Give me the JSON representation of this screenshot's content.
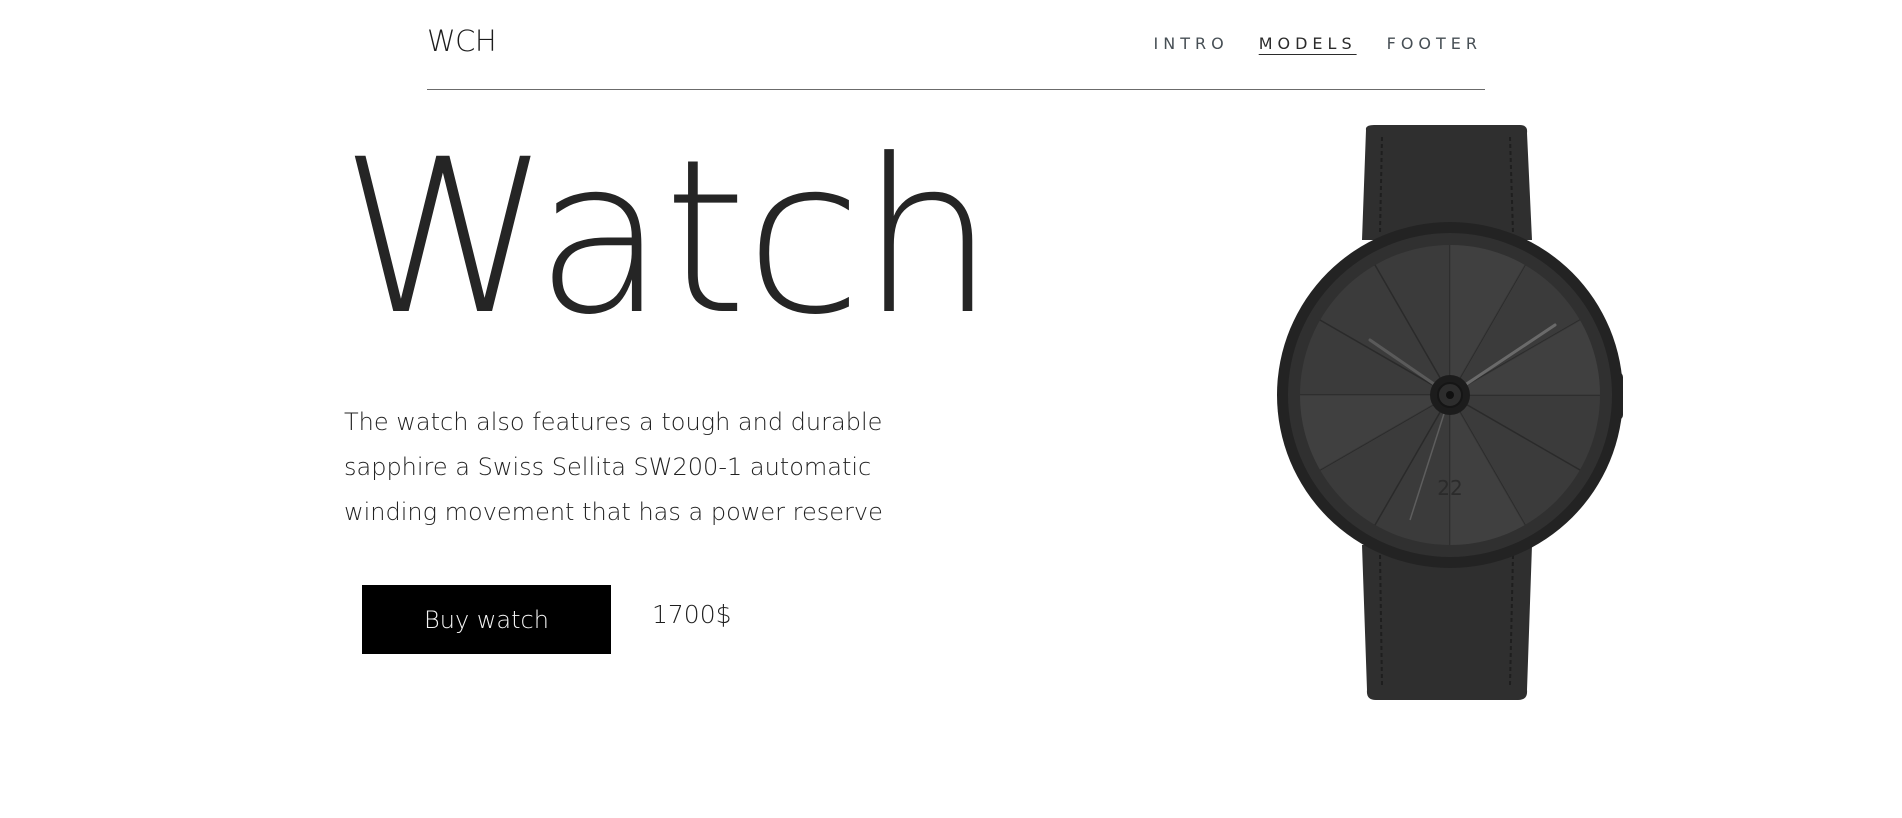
{
  "header": {
    "logo": "WCH",
    "nav": [
      {
        "label": "INTRO",
        "active": false
      },
      {
        "label": "MODELS",
        "active": true
      },
      {
        "label": "FOOTER",
        "active": false
      }
    ]
  },
  "hero": {
    "title": "Watch",
    "description": "The watch also features a tough and durable sapphire a Swiss Sellita SW200-1 automatic winding movement that has a power reserve",
    "buy_label": "Buy watch",
    "price": "1700$"
  },
  "watch": {
    "dial_number": "22"
  },
  "colors": {
    "background": "#ffffff",
    "button": "#000000",
    "button_text": "#f5f5f5",
    "watch_body": "#2a2a2a",
    "text": "#1f1f1f"
  }
}
